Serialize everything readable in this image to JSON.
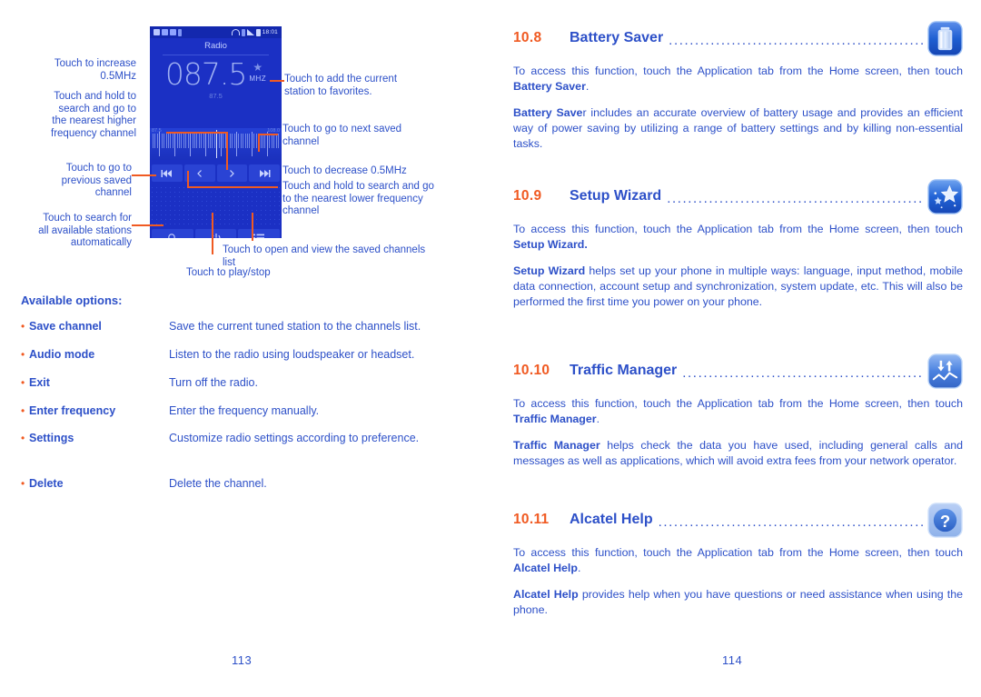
{
  "left_page": {
    "phone": {
      "status_bar": {
        "time": "18:01",
        "left_icons": [
          "play-icon",
          "sync-icon",
          "sim-icon",
          "usb-icon"
        ],
        "right_icons": [
          "headset-icon",
          "vibrate-icon",
          "signal-icon",
          "battery-icon"
        ]
      },
      "app_title": "Radio",
      "frequency": "087.5",
      "unit": "MHZ",
      "sub_frequency": "87.5",
      "favorite_icon": "star-icon",
      "tuner": {
        "min_label": "87.5",
        "max_label": "108.0"
      },
      "nav_buttons": [
        {
          "name": "previous-saved-channel-button",
          "glyph": "skip-back-icon"
        },
        {
          "name": "decrease-frequency-button",
          "glyph": "chevron-left-icon"
        },
        {
          "name": "increase-frequency-button",
          "glyph": "chevron-right-icon"
        },
        {
          "name": "next-saved-channel-button",
          "glyph": "skip-forward-icon"
        }
      ],
      "action_buttons": [
        {
          "name": "scan-stations-button",
          "glyph": "search-icon"
        },
        {
          "name": "play-stop-button",
          "glyph": "power-icon"
        },
        {
          "name": "saved-channels-list-button",
          "glyph": "list-icon"
        }
      ]
    },
    "callouts": {
      "increase": "Touch to increase\n0.5MHz",
      "search_higher": "Touch and hold to\nsearch and go to\nthe nearest higher\nfrequency channel",
      "previous_saved": "Touch to go to\nprevious saved\nchannel",
      "search_all": "Touch to search for\nall available stations\nautomatically",
      "add_favorite": "Touch to add the current\nstation to favorites.",
      "next_saved": "Touch to go to next saved\nchannel",
      "decrease": "Touch to decrease 0.5MHz",
      "search_lower": "Touch and hold to search and go\nto the nearest lower frequency\nchannel",
      "saved_list": "Touch to open and view the saved channels\nlist",
      "play_stop": "Touch to play/stop"
    },
    "options": {
      "title": "Available options:",
      "items": [
        {
          "term": "Save channel",
          "desc": "Save the current tuned station to the channels list."
        },
        {
          "term": "Audio mode",
          "desc": "Listen to the radio using loudspeaker or headset."
        },
        {
          "term": "Exit",
          "desc": "Turn off the radio."
        },
        {
          "term": "Enter frequency",
          "desc": "Enter the frequency manually."
        },
        {
          "term": "Settings",
          "desc": "Customize radio settings according to preference."
        },
        {
          "term": "Delete",
          "desc": "Delete the channel."
        }
      ]
    },
    "page_number": "113"
  },
  "right_page": {
    "sections": [
      {
        "number": "10.8",
        "title": "Battery Saver",
        "icon": "battery-saver-icon",
        "paragraphs": [
          {
            "parts": [
              {
                "t": "To access this function, touch the Application tab from the Home screen, then touch ",
                "b": false
              },
              {
                "t": "Battery Saver",
                "b": true
              },
              {
                "t": ".",
                "b": false
              }
            ]
          },
          {
            "parts": [
              {
                "t": "Battery Save",
                "b": true
              },
              {
                "t": "r includes an accurate overview of battery usage and provides an efficient way of power saving by utilizing a range of battery settings and by killing non-essential tasks.",
                "b": false
              }
            ]
          }
        ]
      },
      {
        "number": "10.9",
        "title": "Setup Wizard",
        "icon": "setup-wizard-icon",
        "paragraphs": [
          {
            "parts": [
              {
                "t": "To access this function, touch the Application tab from the Home screen, then touch ",
                "b": false
              },
              {
                "t": "Setup Wizard.",
                "b": true
              }
            ]
          },
          {
            "parts": [
              {
                "t": "Setup Wizard",
                "b": true
              },
              {
                "t": " helps set up your phone in multiple ways:  language, input method, mobile data connection, account setup and synchronization, system update, etc. This will also be performed the first time you power on your phone.",
                "b": false
              }
            ]
          }
        ]
      },
      {
        "number": "10.10",
        "title": "Traffic Manager",
        "icon": "traffic-manager-icon",
        "paragraphs": [
          {
            "parts": [
              {
                "t": "To access this function, touch the Application tab from the Home screen, then touch ",
                "b": false
              },
              {
                "t": "Traffic Manager",
                "b": true
              },
              {
                "t": ".",
                "b": false
              }
            ]
          },
          {
            "parts": [
              {
                "t": "Traffic Manager",
                "b": true
              },
              {
                "t": " helps check the data you have used, including general calls and messages as well as applications, which will avoid extra fees from your network operator.",
                "b": false
              }
            ]
          }
        ]
      },
      {
        "number": "10.11",
        "title": "Alcatel Help",
        "icon": "alcatel-help-icon",
        "paragraphs": [
          {
            "parts": [
              {
                "t": "To access this function, touch the Application tab from the Home screen, then touch ",
                "b": false
              },
              {
                "t": "Alcatel Help",
                "b": true
              },
              {
                "t": ".",
                "b": false
              }
            ]
          },
          {
            "parts": [
              {
                "t": "Alcatel Help",
                "b": true
              },
              {
                "t": " provides help when you have questions or need assistance when using the phone.",
                "b": false
              }
            ]
          }
        ]
      }
    ],
    "page_number": "114"
  },
  "colors": {
    "blue_text": "#2d50c8",
    "orange_accent": "#f05a22",
    "phone_bg": "#1b30c4"
  }
}
